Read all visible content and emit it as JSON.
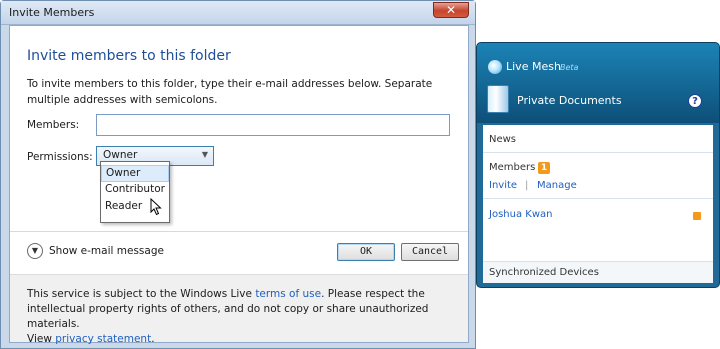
{
  "dialog": {
    "title": "Invite Members",
    "close_glyph": "✕",
    "heading": "Invite members to this folder",
    "description": "To invite members to this folder, type their e-mail addresses below. Separate multiple addresses with semicolons.",
    "members_label": "Members:",
    "members_value": "",
    "permissions_label": "Permissions:",
    "permissions_value": "Owner",
    "permission_options": [
      "Owner",
      "Contributor",
      "Reader"
    ],
    "show_email_label": "Show e-mail message",
    "ok_label": "OK",
    "cancel_label": "Cancel",
    "footer": {
      "line1_prefix": "This service is subject to the Windows Live ",
      "terms_link": "terms of use",
      "line1_suffix": ". Please respect the intellectual property rights of others, and do not copy or share unauthorized materials.",
      "view_prefix": "View ",
      "privacy_link": "privacy statement",
      "view_suffix": "."
    }
  },
  "mesh": {
    "brand": "Live Mesh",
    "beta": "Beta",
    "folder_name": "Private Documents",
    "help_glyph": "?",
    "news_label": "News",
    "members_label": "Members",
    "members_badge": "1",
    "invite_link": "Invite",
    "divider": "|",
    "manage_link": "Manage",
    "member_name": "Joshua Kwan",
    "synced_devices_label": "Synchronized Devices"
  },
  "colors": {
    "accent": "#1f4e99",
    "link": "#1f5fbf",
    "mesh_blue": "#1f6a96",
    "badge_orange": "#f39a1c"
  }
}
